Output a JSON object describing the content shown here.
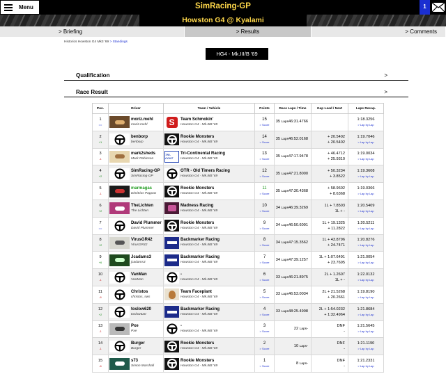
{
  "header": {
    "menu_label": "Menu",
    "site_title": "SimRacing-GP",
    "notification_count": "1"
  },
  "banner": {
    "title": "Howston G4 @ Kyalami"
  },
  "tabs": [
    {
      "label": "> Briefing"
    },
    {
      "label": "> Results"
    },
    {
      "label": "> Comments"
    }
  ],
  "breadcrumb": {
    "root": "Historics",
    "event": "Howston G4 Mk3 '69",
    "current": "> Standings"
  },
  "event_button": "HG4 - Mk.III/B '69",
  "sections": {
    "qualification": "Qualification",
    "race_result": "Race Result",
    "arrow": ">"
  },
  "table": {
    "headers": [
      "Pos.",
      "Driver",
      "Team / Vehicle",
      "Points",
      "Race Laps / Time",
      "Gap Lead / Next",
      "Laps Recap."
    ],
    "score_label": "> Score",
    "lap_by_lap_label": "> Lap by Lap",
    "laps_suffix": "Laps",
    "rows": [
      {
        "pos": "1",
        "change": "==",
        "driver": "moriz.mehl",
        "driver_sub": "moriz.mehl",
        "team": "Team Schmokin'",
        "vehicle": "Howston G4 - Mk.IIIB '69",
        "points": "15",
        "laps": "35",
        "time": "46:31.4766",
        "gap_lead": "",
        "gap_next": "",
        "recap": "1:18.3256"
      },
      {
        "pos": "2",
        "change": "+1",
        "driver": "benborp",
        "driver_sub": "benborp",
        "team": "Rookie Monsters",
        "vehicle": "Howston G4 - Mk.IIIB '69",
        "points": "14",
        "laps": "35",
        "time": "46:52.0168",
        "gap_lead": "+ 20.5402",
        "gap_next": "+ 20.5402",
        "recap": "1:19.7046"
      },
      {
        "pos": "3",
        "change": "-1",
        "driver": "mark2sheds",
        "driver_sub": "Mark Robinson",
        "team": "Tri-Continental Racing",
        "vehicle": "Howston G4 - Mk.IIIB '69",
        "points": "13",
        "laps": "35",
        "time": "47:17.9478",
        "gap_lead": "+ 46.4712",
        "gap_next": "+ 25.9310",
        "recap": "1:19.0034"
      },
      {
        "pos": "4",
        "change": "+2",
        "driver": "SimRacing-GP",
        "driver_sub": "SimRacing-GP",
        "team": "OTR - Old Timers Racing",
        "vehicle": "Howston G4 - Mk.IIIB '69",
        "points": "12",
        "laps": "35",
        "time": "47:21.8000",
        "gap_lead": "+ 50.3234",
        "gap_next": "+ 3.8522",
        "recap": "1:19.3608"
      },
      {
        "pos": "5",
        "change": "-1",
        "driver": "marmagas",
        "driver_sub": "Dimitrios Pappas",
        "team": "Rookie Monsters",
        "vehicle": "Howston G4 - Mk.IIIB '69",
        "points": "11",
        "laps": "35",
        "time": "47:30.4368",
        "gap_lead": "+ 58.9602",
        "gap_next": "+ 8.6368",
        "recap": "1:19.0366"
      },
      {
        "pos": "6",
        "change": "+2",
        "driver": "TheLichten",
        "driver_sub": "The Lichten",
        "team": "Madness Racing",
        "vehicle": "Howston G4 - Mk.IIIB '69",
        "points": "10",
        "laps": "34",
        "time": "46:39.3269",
        "gap_lead": "1L + 7.8503",
        "gap_next": "1L + -",
        "recap": "1:20.5409"
      },
      {
        "pos": "7",
        "change": "==",
        "driver": "David Plummer",
        "driver_sub": "David Plummer",
        "team": "Rookie Monsters",
        "vehicle": "Howston G4 - Mk.IIIB '69",
        "points": "9",
        "laps": "34",
        "time": "46:50.6091",
        "gap_lead": "1L + 19.1325",
        "gap_next": "+ 11.2822",
        "recap": "1:20.5211"
      },
      {
        "pos": "8",
        "change": "+2",
        "driver": "VirusGR42",
        "driver_sub": "VirusGR42",
        "team": "Backmarker Racing",
        "vehicle": "Howston G4 - Mk.IIIB '69",
        "points": "8",
        "laps": "34",
        "time": "47:15.3562",
        "gap_lead": "1L + 43.8796",
        "gap_next": "+ 24.7471",
        "recap": "1:20.8276"
      },
      {
        "pos": "9",
        "change": "+6",
        "driver": "Jcadams3",
        "driver_sub": "jcadams3",
        "team": "Backmarker Racing",
        "vehicle": "Howston G4 - Mk.IIIB '69",
        "points": "7",
        "laps": "34",
        "time": "47:39.1257",
        "gap_lead": "1L + 1:07.6491",
        "gap_next": "+ 23.7695",
        "recap": "1:21.0054"
      },
      {
        "pos": "10",
        "change": "-1",
        "driver": "VanMan",
        "driver_sub": "VanMan",
        "team": "-",
        "vehicle": "Howston G4 - Mk.IIIB '69",
        "points": "6",
        "laps": "33",
        "time": "46:21.8975",
        "gap_lead": "2L + 1.2607",
        "gap_next": "1L + -",
        "recap": "1:22.0132"
      },
      {
        "pos": "11",
        "change": "-6",
        "driver": "Christos",
        "driver_sub": "christos_sws",
        "team": "Team Faceplant",
        "vehicle": "Howston G4 - Mk.IIIB '69",
        "points": "5",
        "laps": "33",
        "time": "46:53.0034",
        "gap_lead": "2L + 21.5268",
        "gap_next": "+ 20.2661",
        "recap": "1:19.8190"
      },
      {
        "pos": "12",
        "change": "+2",
        "driver": "toslow620",
        "driver_sub": "toslow620",
        "team": "Backmarker Racing",
        "vehicle": "Howston G4 - Mk.IIIB '69",
        "points": "4",
        "laps": "33",
        "time": "48:25.4998",
        "gap_lead": "2L + 1:54.0232",
        "gap_next": "+ 1:32.4964",
        "recap": "1:21.8684"
      },
      {
        "pos": "13",
        "change": "-1",
        "driver": "Pxe",
        "driver_sub": "Pxe",
        "team": "-",
        "vehicle": "Howston G4 - Mk.IIIB '69",
        "points": "3",
        "laps": "22",
        "time": "-",
        "gap_lead": "DNF",
        "gap_next": "-",
        "recap": "1:21.5645"
      },
      {
        "pos": "14",
        "change": "-1",
        "driver": "Burger",
        "driver_sub": "Burger",
        "team": "Rookie Monsters",
        "vehicle": "Howston G4 - Mk.IIIB '69",
        "points": "2",
        "laps": "10",
        "time": "-",
        "gap_lead": "DNF",
        "gap_next": "-",
        "recap": "1:21.1190"
      },
      {
        "pos": "15",
        "change": "-6",
        "driver": "s73",
        "driver_sub": "Simon Marshall",
        "team": "Rookie Monsters",
        "vehicle": "Howston G4 - Mk.IIIB '69",
        "points": "1",
        "laps": "8",
        "time": "-",
        "gap_lead": "DNF",
        "gap_next": "-",
        "recap": "1:21.2331"
      }
    ]
  },
  "colors": {
    "title_yellow": "#ffd84a",
    "link_blue": "#1b2fd1",
    "gain_green": "#198a19",
    "loss_red": "#c82020"
  }
}
